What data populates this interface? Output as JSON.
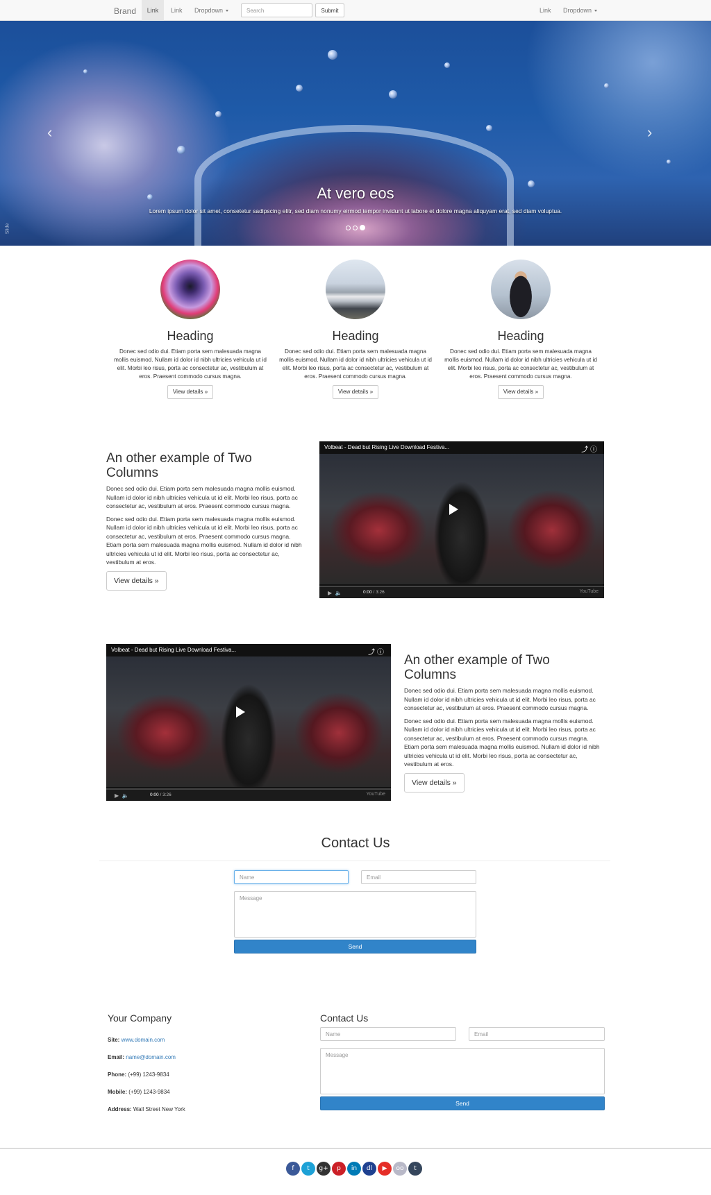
{
  "navbar": {
    "brand": "Brand",
    "link1": "Link",
    "link2": "Link",
    "dropdown": "Dropdown",
    "search_placeholder": "Search",
    "submit": "Submit",
    "right_link": "Link",
    "right_dropdown": "Dropdown"
  },
  "carousel": {
    "title": "At vero eos",
    "text": "Lorem ipsum dolor sit amet, consetetur sadipscing elitr, sed diam nonumy eirmod tempor invidunt ut labore et dolore magna aliquyam erat, sed diam voluptua.",
    "prev_icon": "chevron-left-icon",
    "next_icon": "chevron-right-icon",
    "side_label": "Slide",
    "active_slide": 3,
    "slide_count": 3
  },
  "marketing": [
    {
      "image": "flower-photo",
      "heading": "Heading",
      "text": "Donec sed odio dui. Etiam porta sem malesuada magna mollis euismod. Nullam id dolor id nibh ultricies vehicula ut id elit. Morbi leo risus, porta ac consectetur ac, vestibulum at eros. Praesent commodo cursus magna.",
      "button": "View details »"
    },
    {
      "image": "train-photo",
      "heading": "Heading",
      "text": "Donec sed odio dui. Etiam porta sem malesuada magna mollis euismod. Nullam id dolor id nibh ultricies vehicula ut id elit. Morbi leo risus, porta ac consectetur ac, vestibulum at eros. Praesent commodo cursus magna.",
      "button": "View details »"
    },
    {
      "image": "business-people-photo",
      "heading": "Heading",
      "text": "Donec sed odio dui. Etiam porta sem malesuada magna mollis euismod. Nullam id dolor id nibh ultricies vehicula ut id elit. Morbi leo risus, porta ac consectetur ac, vestibulum at eros. Praesent commodo cursus magna.",
      "button": "View details »"
    }
  ],
  "featurettes": [
    {
      "heading": "An other example of Two Columns",
      "p1": "Donec sed odio dui. Etiam porta sem malesuada magna mollis euismod. Nullam id dolor id nibh ultricies vehicula ut id elit. Morbi leo risus, porta ac consectetur ac, vestibulum at eros. Praesent commodo cursus magna.",
      "p2": "Donec sed odio dui. Etiam porta sem malesuada magna mollis euismod. Nullam id dolor id nibh ultricies vehicula ut id elit. Morbi leo risus, porta ac consectetur ac, vestibulum at eros. Praesent commodo cursus magna. Etiam porta sem malesuada magna mollis euismod. Nullam id dolor id nibh ultricies vehicula ut id elit. Morbi leo risus, porta ac consectetur ac, vestibulum at eros.",
      "button": "View details »",
      "video": {
        "title": "Volbeat - Dead but Rising Live Download Festiva...",
        "time_current": "0:00",
        "time_total": "/ 3:26",
        "logo": "YouTube"
      }
    },
    {
      "heading": "An other example of Two Columns",
      "p1": "Donec sed odio dui. Etiam porta sem malesuada magna mollis euismod. Nullam id dolor id nibh ultricies vehicula ut id elit. Morbi leo risus, porta ac consectetur ac, vestibulum at eros. Praesent commodo cursus magna.",
      "p2": "Donec sed odio dui. Etiam porta sem malesuada magna mollis euismod. Nullam id dolor id nibh ultricies vehicula ut id elit. Morbi leo risus, porta ac consectetur ac, vestibulum at eros. Praesent commodo cursus magna. Etiam porta sem malesuada magna mollis euismod. Nullam id dolor id nibh ultricies vehicula ut id elit. Morbi leo risus, porta ac consectetur ac, vestibulum at eros.",
      "button": "View details »",
      "video": {
        "title": "Volbeat - Dead but Rising Live Download Festiva...",
        "time_current": "0:00",
        "time_total": "/ 3:26",
        "logo": "YouTube"
      }
    }
  ],
  "contact": {
    "title": "Contact Us",
    "name_placeholder": "Name",
    "email_placeholder": "Email",
    "message_placeholder": "Message",
    "send": "Send"
  },
  "footer": {
    "company_title": "Your Company",
    "site_label": "Site:",
    "site_value": "www.domain.com",
    "email_label": "Email:",
    "email_value": "name@domain.com",
    "phone_label": "Phone:",
    "phone_value": "(+99) 1243-9834",
    "mobile_label": "Mobile:",
    "mobile_value": "(+99) 1243-9834",
    "address_label": "Address:",
    "address_value": "Wall Street New York",
    "contact_title": "Contact Us",
    "name_placeholder": "Name",
    "email_placeholder": "Email",
    "message_placeholder": "Message",
    "send": "Send"
  },
  "social": [
    {
      "icon": "facebook-icon",
      "glyph": "f",
      "color": "#3b5998"
    },
    {
      "icon": "twitter-icon",
      "glyph": "t",
      "color": "#1da1d6"
    },
    {
      "icon": "google-plus-icon",
      "glyph": "g+",
      "color": "#333333"
    },
    {
      "icon": "pinterest-icon",
      "glyph": "p",
      "color": "#cb2027"
    },
    {
      "icon": "linkedin-icon",
      "glyph": "in",
      "color": "#007bb6"
    },
    {
      "icon": "delicious-icon",
      "glyph": "dl",
      "color": "#1f4190"
    },
    {
      "icon": "youtube-icon",
      "glyph": "▶",
      "color": "#e52d27"
    },
    {
      "icon": "flickr-icon",
      "glyph": "oo",
      "color": "#b9b9c8"
    },
    {
      "icon": "tumblr-icon",
      "glyph": "t",
      "color": "#35465c"
    }
  ],
  "colors": {
    "primary_button": "#3184c9",
    "link": "#337ab7",
    "navbar_bg": "#f8f8f8"
  }
}
